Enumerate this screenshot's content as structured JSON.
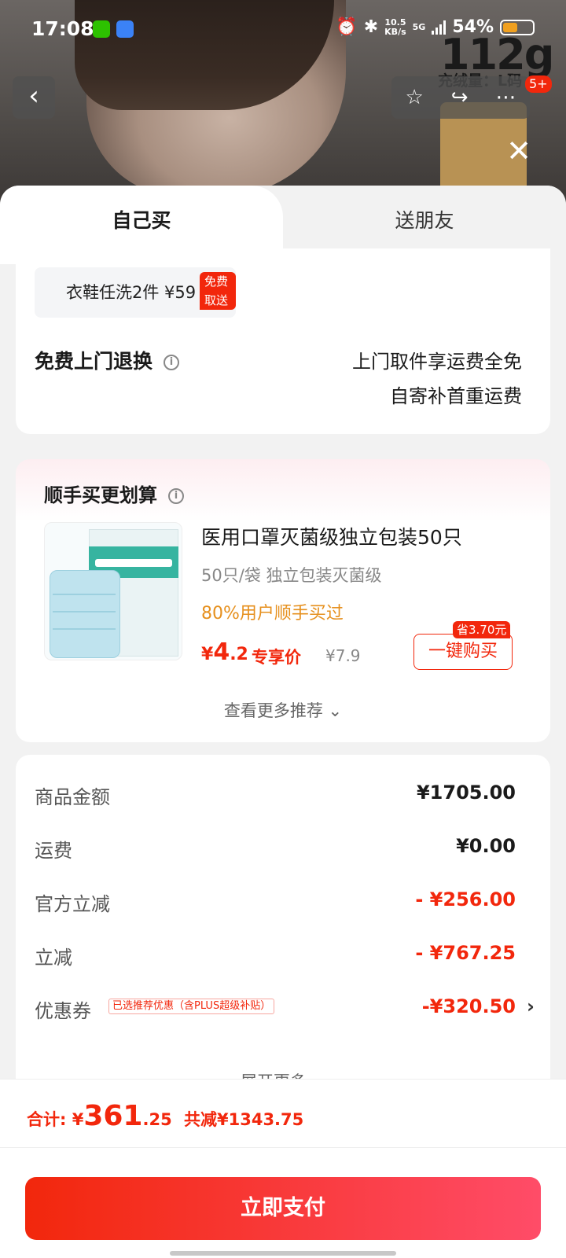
{
  "status_bar": {
    "time": "17:08",
    "speed": "10.5",
    "speed_unit": "KB/s",
    "network": "5G",
    "battery": "54%"
  },
  "hero": {
    "weight": "112g",
    "fill": "充绒量：L码",
    "badge": "5+"
  },
  "tabs": {
    "self": "自己买",
    "friend": "送朋友"
  },
  "service": {
    "wash_label": "衣鞋任洗2件  ¥59",
    "wash_tag": "免费取送",
    "return_title": "免费上门退换",
    "return_line1": "上门取件享运费全免",
    "return_line2": "自寄补首重运费"
  },
  "addon": {
    "title": "顺手买更划算",
    "product_name": "医用口罩灭菌级独立包装50只",
    "spec": "50只/袋 独立包装灭菌级",
    "users": "80%用户顺手买过",
    "price_symbol": "¥",
    "price_int": "4",
    "price_dec": ".2",
    "price_tag": "专享价",
    "orig_price": "¥7.9",
    "save_tag": "省3.70元",
    "buy_label": "一键购买",
    "more": "查看更多推荐 ⌄"
  },
  "summary": {
    "rows": [
      {
        "label": "商品金额",
        "value": "¥1705.00"
      },
      {
        "label": "运费",
        "value": "¥0.00"
      },
      {
        "label": "官方立减",
        "value": "- ¥256.00"
      },
      {
        "label": "立减",
        "value": "- ¥767.25"
      },
      {
        "label": "优惠券",
        "value": "-¥320.50"
      }
    ],
    "coupon_tag": "已选推荐优惠（含PLUS超级补贴）",
    "expand": "展开更多 ⌄"
  },
  "footer": {
    "total_label": "合计: ¥",
    "total_int": "361",
    "total_dec": ".25",
    "discount": "共减¥1343.75",
    "pay_label": "立即支付"
  },
  "colors": {
    "accent": "#f2270c",
    "orange": "#e6901e"
  }
}
